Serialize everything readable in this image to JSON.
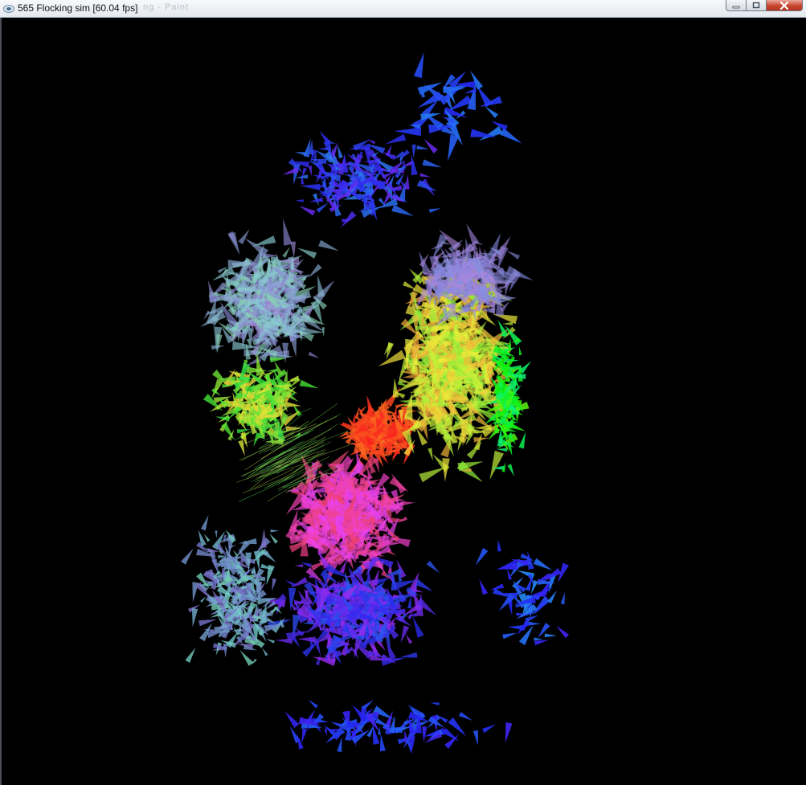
{
  "window": {
    "title": "565 Flocking sim [60.04 fps]",
    "ghost_title": "ng - Paint",
    "icon": "app-icon",
    "controls": {
      "minimize_icon": "minimize-icon",
      "maximize_icon": "maximize-icon",
      "close_icon": "close-icon"
    }
  },
  "canvas": {
    "background": "#000000",
    "boid_palette": [
      "#ff2a2a",
      "#ff7a1a",
      "#e8c21a",
      "#a6f21a",
      "#3cf03c",
      "#2ee6a8",
      "#29b8f5",
      "#2f6cff",
      "#4a2cff",
      "#9a30ff",
      "#ff2fd2",
      "#a8b4ff",
      "#8fe6b4",
      "#d2a0ff"
    ]
  }
}
